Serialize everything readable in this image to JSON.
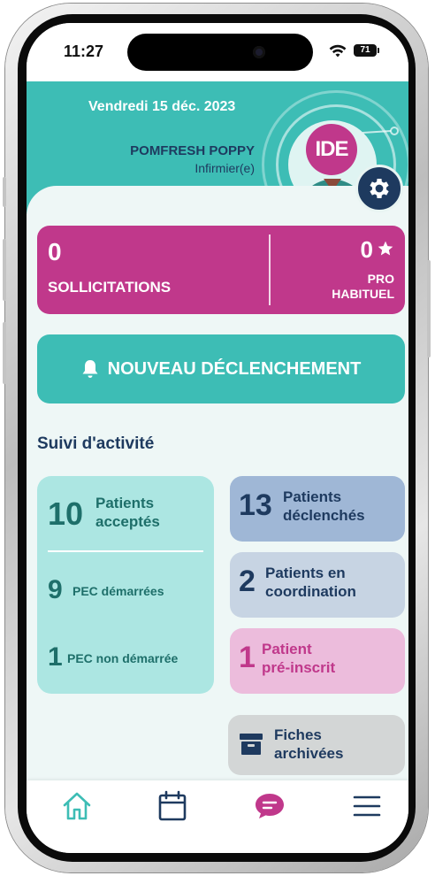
{
  "status_bar": {
    "time": "11:27",
    "battery": "71"
  },
  "header": {
    "date": "Vendredi 15 déc. 2023",
    "user_name": "POMFRESH POPPY",
    "role": "Infirmier(e)",
    "badge": "IDE",
    "settings_icon": "gear-icon"
  },
  "solicitations": {
    "count": "0",
    "label": "SOLLICITATIONS",
    "pro_count": "0",
    "pro_label_line1": "PRO",
    "pro_label_line2": "HABITUEL",
    "star_icon": "star-icon"
  },
  "new_trigger": {
    "label": "NOUVEAU DÉCLENCHEMENT",
    "icon": "bell-icon"
  },
  "activity": {
    "title": "Suivi d'activité",
    "accepted": {
      "count": "10",
      "line1": "Patients",
      "line2": "acceptés"
    },
    "pec_started": {
      "count": "9",
      "label": "PEC démarrées"
    },
    "pec_not_started": {
      "count": "1",
      "label": "PEC non démarrée"
    },
    "triggered": {
      "count": "13",
      "line1": "Patients",
      "line2": "déclenchés"
    },
    "coordination": {
      "count": "2",
      "line1": "Patients en",
      "line2": "coordination"
    },
    "preregistered": {
      "count": "1",
      "line1": "Patient",
      "line2": "pré-inscrit"
    },
    "archived": {
      "line1": "Fiches",
      "line2": "archivées",
      "icon": "archive-box-icon"
    }
  },
  "tabbar": {
    "items": [
      {
        "name": "home",
        "icon": "home-icon"
      },
      {
        "name": "calendar",
        "icon": "calendar-icon"
      },
      {
        "name": "messages",
        "icon": "chat-bubble-icon",
        "active": true
      },
      {
        "name": "menu",
        "icon": "hamburger-menu-icon"
      }
    ]
  },
  "colors": {
    "teal": "#3dbdb5",
    "magenta": "#c0388b",
    "navy": "#1e3a5f",
    "light_teal": "#ace6e2",
    "blue_card": "#9fb7d6",
    "grey_blue_card": "#c7d4e3",
    "pink_card": "#ecbcdc",
    "grey_card": "#d3d6d6"
  }
}
